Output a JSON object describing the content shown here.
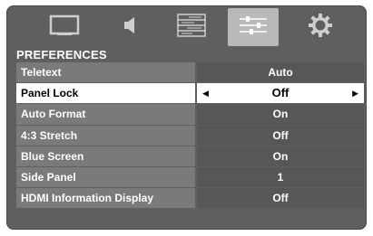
{
  "tabs": [
    {
      "icon": "picture-icon"
    },
    {
      "icon": "sound-icon"
    },
    {
      "icon": "setup-list-icon"
    },
    {
      "icon": "preferences-sliders-icon",
      "active": true
    },
    {
      "icon": "settings-gear-icon"
    }
  ],
  "menu": {
    "title": "PREFERENCES",
    "rows": [
      {
        "label": "Teletext",
        "value": "Auto"
      },
      {
        "label": "Panel Lock",
        "value": "Off",
        "selected": true
      },
      {
        "label": "Auto Format",
        "value": "On"
      },
      {
        "label": "4:3 Stretch",
        "value": "Off"
      },
      {
        "label": "Blue Screen",
        "value": "On"
      },
      {
        "label": "Side Panel",
        "value": "1"
      },
      {
        "label": "HDMI Information Display",
        "value": "Off"
      }
    ]
  },
  "colors": {
    "panel_bg": "#5f5f5f",
    "label_bg": "#7a7a7a",
    "value_bg": "#575757",
    "selected_bg": "#ffffff",
    "active_tab_bg": "#b9b9b9"
  }
}
